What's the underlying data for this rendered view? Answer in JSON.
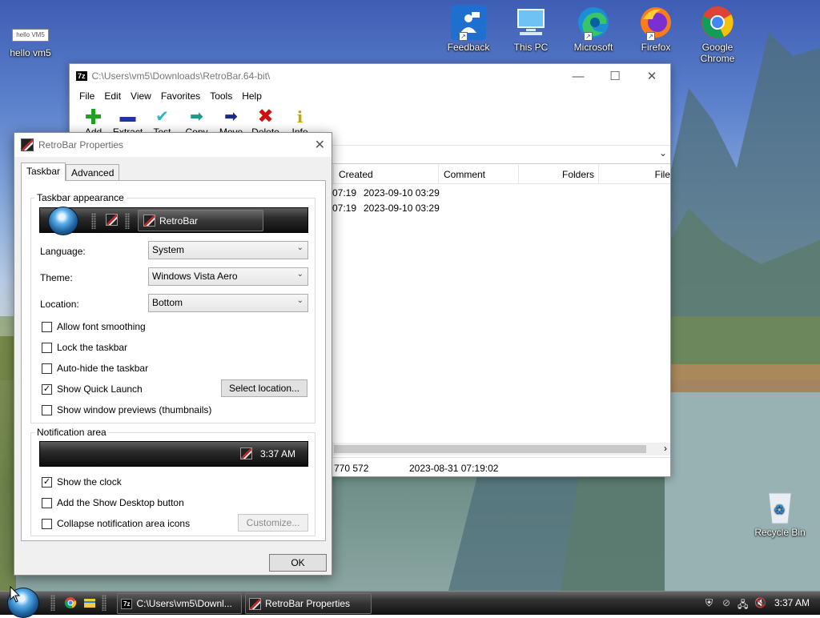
{
  "desktop": {
    "icons": [
      {
        "label": "hello vm5",
        "badge": "hello VM5"
      },
      {
        "label": "Feedback Hub"
      },
      {
        "label": "This PC"
      },
      {
        "label": "Microsoft Edge"
      },
      {
        "label": "Firefox"
      },
      {
        "label": "Google Chrome"
      },
      {
        "label": "Recycle Bin"
      }
    ]
  },
  "file_manager": {
    "app_badge": "7z",
    "title": "C:\\Users\\vm5\\Downloads\\RetroBar.64-bit\\",
    "menu": [
      "File",
      "Edit",
      "View",
      "Favorites",
      "Tools",
      "Help"
    ],
    "toolbar": [
      {
        "label": "Add",
        "icon": "plus-icon",
        "color": "#1fa01f"
      },
      {
        "label": "Extract",
        "icon": "minus-icon",
        "color": "#2233aa"
      },
      {
        "label": "Test",
        "icon": "check-icon",
        "color": "#2bb5c0"
      },
      {
        "label": "Copy",
        "icon": "copy-arrow-icon",
        "color": "#1b9a8a"
      },
      {
        "label": "Move",
        "icon": "move-arrow-icon",
        "color": "#1a2a8a"
      },
      {
        "label": "Delete",
        "icon": "x-icon",
        "color": "#cc1111"
      },
      {
        "label": "Info",
        "icon": "info-icon",
        "color": "#c8a800"
      }
    ],
    "columns": [
      "Created",
      "Comment",
      "Folders",
      "File"
    ],
    "rows": [
      {
        "modified_tail": "07:19",
        "created": "2023-09-10 03:29"
      },
      {
        "modified_tail": "07:19",
        "created": "2023-09-10 03:29"
      }
    ],
    "status": {
      "size": "770 572",
      "date": "2023-08-31 07:19:02"
    }
  },
  "dialog": {
    "title": "RetroBar Properties",
    "tabs": [
      "Taskbar",
      "Advanced"
    ],
    "taskbar_appearance": {
      "legend": "Taskbar appearance",
      "preview_button": "RetroBar"
    },
    "language": {
      "label": "Language:",
      "value": "System"
    },
    "theme": {
      "label": "Theme:",
      "value": "Windows Vista Aero"
    },
    "location": {
      "label": "Location:",
      "value": "Bottom"
    },
    "options": [
      {
        "label": "Allow font smoothing",
        "checked": false
      },
      {
        "label": "Lock the taskbar",
        "checked": false
      },
      {
        "label": "Auto-hide the taskbar",
        "checked": false
      },
      {
        "label": "Show Quick Launch",
        "checked": true
      },
      {
        "label": "Show window previews (thumbnails)",
        "checked": false
      }
    ],
    "select_location_button": "Select location...",
    "notification_area": {
      "legend": "Notification area",
      "preview_time": "3:37 AM",
      "options": [
        {
          "label": "Show the clock",
          "checked": true
        },
        {
          "label": "Add the Show Desktop button",
          "checked": false
        },
        {
          "label": "Collapse notification area icons",
          "checked": false
        }
      ],
      "customize_button": "Customize..."
    },
    "ok_button": "OK"
  },
  "taskbar": {
    "tasks": [
      {
        "label": "C:\\Users\\vm5\\Downl...",
        "badge": "7z"
      },
      {
        "label": "RetroBar Properties"
      }
    ],
    "clock": "3:37 AM"
  }
}
